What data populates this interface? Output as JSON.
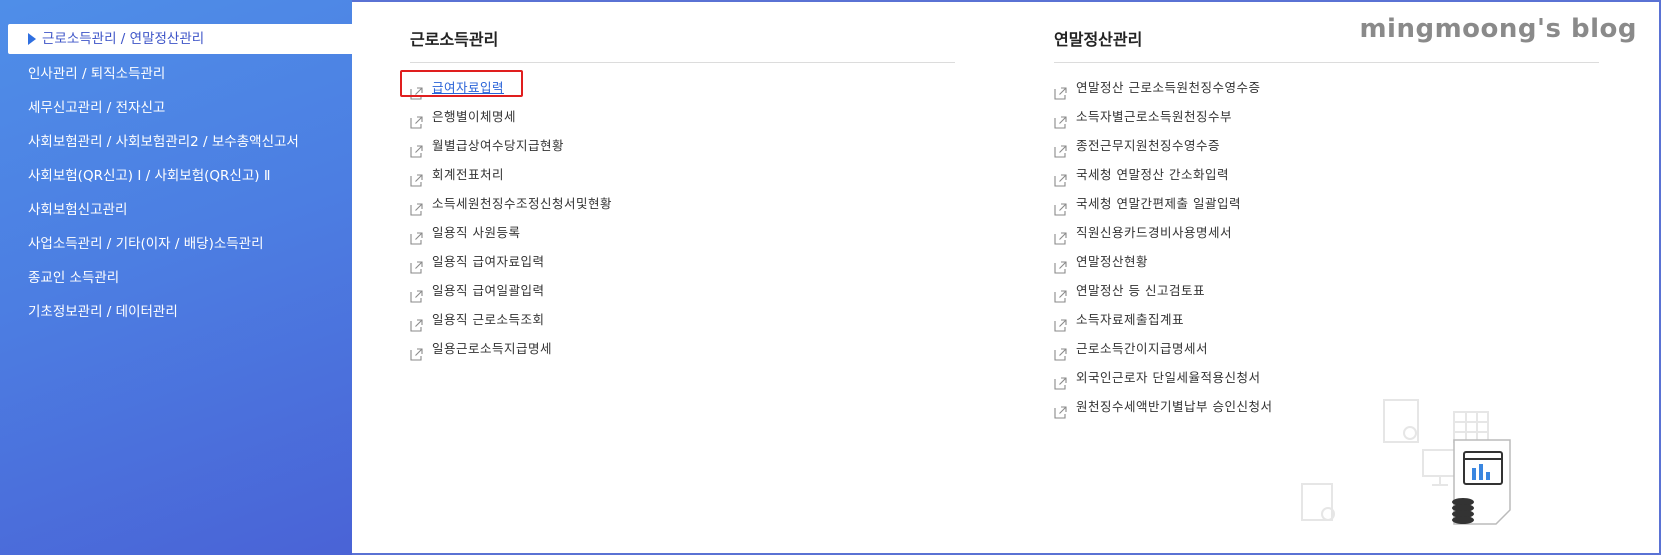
{
  "sidebar": {
    "items": [
      {
        "label": "근로소득관리 / 연말정산관리",
        "active": true
      },
      {
        "label": "인사관리 / 퇴직소득관리"
      },
      {
        "label": "세무신고관리 / 전자신고"
      },
      {
        "label": "사회보험관리 / 사회보험관리2 / 보수총액신고서"
      },
      {
        "label": "사회보험(QR신고) Ⅰ / 사회보험(QR신고) Ⅱ"
      },
      {
        "label": "사회보험신고관리"
      },
      {
        "label": "사업소득관리 / 기타(이자 / 배당)소득관리"
      },
      {
        "label": "종교인 소득관리"
      },
      {
        "label": "기초정보관리 / 데이터관리"
      }
    ]
  },
  "sections": [
    {
      "title": "근로소득관리",
      "items": [
        "급여자료입력",
        "은행별이체명세",
        "월별급상여수당지급현황",
        "회계전표처리",
        "소득세원천징수조정신청서및현황",
        "일용직 사원등록",
        "일용직 급여자료입력",
        "일용직 급여일괄입력",
        "일용직 근로소득조회",
        "일용근로소득지급명세"
      ]
    },
    {
      "title": "연말정산관리",
      "items": [
        "연말정산 근로소득원천징수영수증",
        "소득자별근로소득원천징수부",
        "종전근무지원천징수영수증",
        "국세청 연말정산 간소화입력",
        "국세청 연말간편제출 일괄입력",
        "직원신용카드경비사용명세서",
        "연말정산현황",
        "연말정산 등 신고검토표",
        "소득자료제출집계표",
        "근로소득간이지급명세서",
        "외국인근로자 단일세율적용신청서",
        "원천징수세액반기별납부 승인신청서"
      ]
    }
  ],
  "watermark": "mingmoong's blog",
  "colors": {
    "sidebar_gradient_start": "#4f8ee8",
    "sidebar_gradient_end": "#4a63d6",
    "highlight_border": "#e01e1e",
    "link_color": "#2a63d8"
  },
  "icons": {
    "menu_item": "external-link-icon",
    "sidebar_active": "caret-right-icon"
  }
}
